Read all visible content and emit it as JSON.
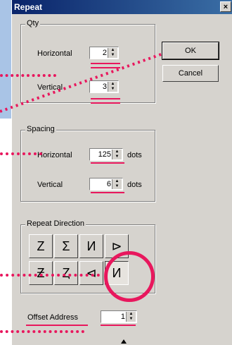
{
  "dialog": {
    "title": "Repeat",
    "close_glyph": "×",
    "ok_label": "OK",
    "cancel_label": "Cancel"
  },
  "qty": {
    "legend": "Qty",
    "horizontal_label": "Horizontal",
    "horizontal_value": "2",
    "vertical_label": "Vertical",
    "vertical_value": "3"
  },
  "spacing": {
    "legend": "Spacing",
    "horizontal_label": "Horizontal",
    "horizontal_value": "125",
    "horizontal_unit": "dots",
    "vertical_label": "Vertical",
    "vertical_value": "6",
    "vertical_unit": "dots"
  },
  "direction": {
    "legend": "Repeat Direction",
    "buttons": [
      {
        "icon": "repeat-dir-z-icon",
        "glyph": "Z"
      },
      {
        "icon": "repeat-dir-s-icon",
        "glyph": "Σ"
      },
      {
        "icon": "repeat-dir-n-icon",
        "glyph": "И"
      },
      {
        "icon": "repeat-dir-arrow-icon",
        "glyph": "⊳"
      },
      {
        "icon": "repeat-dir-z2-icon",
        "glyph": "Ƶ"
      },
      {
        "icon": "repeat-dir-z3-icon",
        "glyph": "Ȥ"
      },
      {
        "icon": "repeat-dir-n2-icon",
        "glyph": "⊲"
      },
      {
        "icon": "repeat-dir-n3-icon",
        "glyph": "И"
      }
    ],
    "selected_index": 7
  },
  "offset": {
    "label": "Offset Address",
    "value": "1"
  },
  "colors": {
    "highlight": "#e8175d",
    "dialog_bg": "#d6d3ce",
    "titlebar": "#0a246a"
  }
}
